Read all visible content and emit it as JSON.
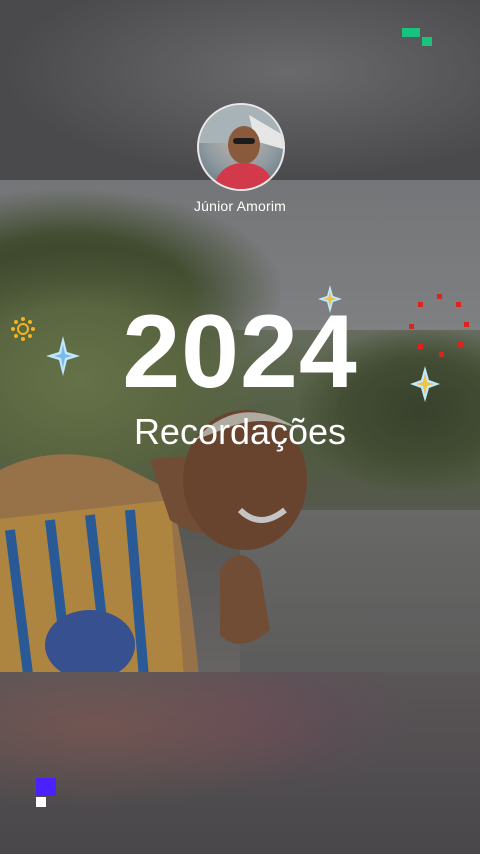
{
  "header": {
    "user_name": "Júnior Amorim",
    "avatar_icon": "user-avatar"
  },
  "title": {
    "year": "2024",
    "subtitle": "Recordações"
  },
  "decor": {
    "brand_green": "#19c37d",
    "brand_purple": "#4b22ff",
    "sparkle_blue": "#bfe9ff",
    "sparkle_gold": "#f0c24a",
    "fireworks_red": "#d8261f",
    "sunburst_yellow": "#f2b51c"
  }
}
